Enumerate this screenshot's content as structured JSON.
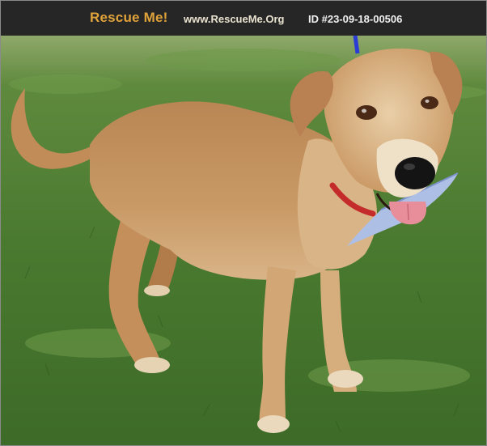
{
  "header": {
    "brand": "Rescue Me!",
    "site": "www.RescueMe.Org",
    "pet_id": "ID #23-09-18-00506"
  },
  "photo": {
    "subject": "dog-photo"
  },
  "colors": {
    "header_bg": "#262626",
    "brand": "#e0a33a",
    "site_text": "#e9e2cf",
    "id_text": "#f0f0f0",
    "grass": "#4d7d34",
    "fur": "#c8955e"
  }
}
